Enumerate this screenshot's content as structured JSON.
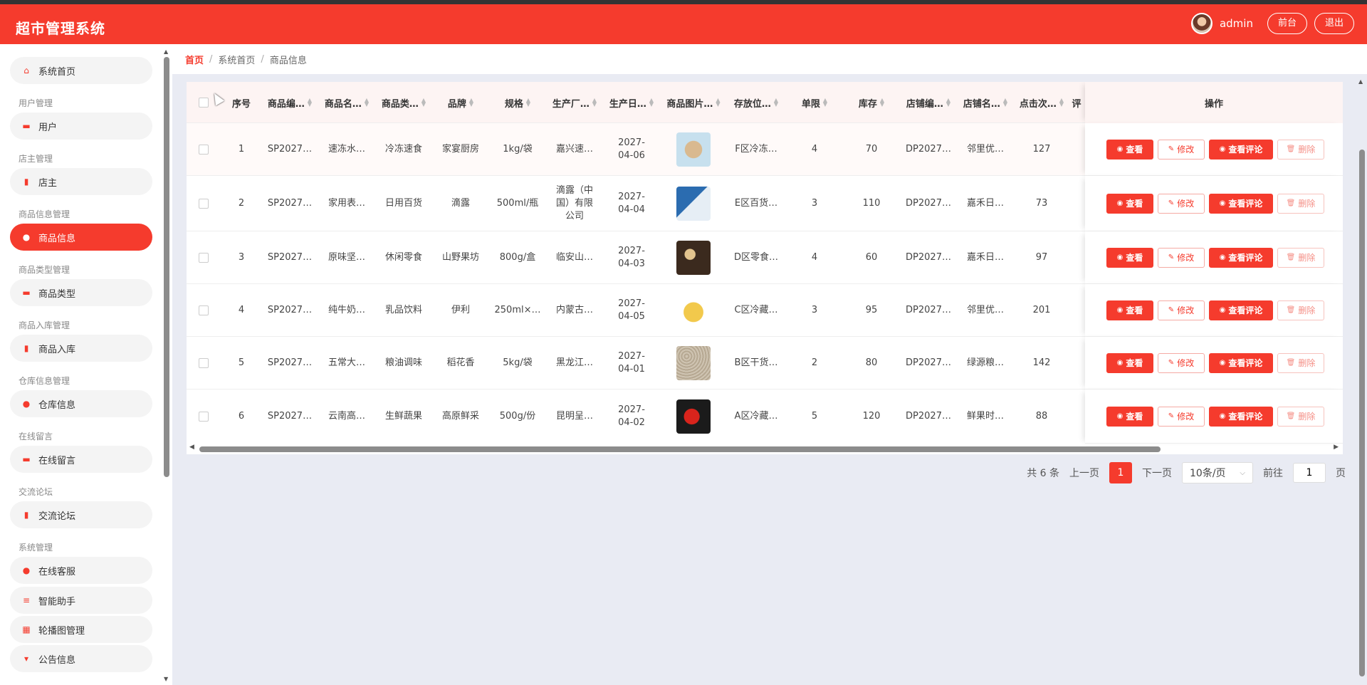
{
  "app": {
    "title": "超市管理系统"
  },
  "header": {
    "user": "admin",
    "front_btn": "前台",
    "logout_btn": "退出"
  },
  "sidebar": {
    "home": "系统首页",
    "groups": [
      {
        "title": "用户管理",
        "item": "用户",
        "icon": "briefcase-icon"
      },
      {
        "title": "店主管理",
        "item": "店主",
        "icon": "bar-chart-icon"
      },
      {
        "title": "商品信息管理",
        "item": "商品信息",
        "icon": "pin-icon"
      },
      {
        "title": "商品类型管理",
        "item": "商品类型",
        "icon": "briefcase-icon"
      },
      {
        "title": "商品入库管理",
        "item": "商品入库",
        "icon": "bar-chart-icon"
      },
      {
        "title": "仓库信息管理",
        "item": "仓库信息",
        "icon": "pin-icon"
      },
      {
        "title": "在线留言",
        "item": "在线留言",
        "icon": "briefcase-icon"
      },
      {
        "title": "交流论坛",
        "item": "交流论坛",
        "icon": "bar-chart-icon"
      }
    ],
    "system_group": "系统管理",
    "system_items": [
      "在线客服",
      "智能助手",
      "轮播图管理",
      "公告信息"
    ],
    "active": "商品信息"
  },
  "breadcrumb": [
    "首页",
    "系统首页",
    "商品信息"
  ],
  "table": {
    "columns": [
      "序号",
      "商品编…",
      "商品名…",
      "商品类…",
      "品牌",
      "规格",
      "生产厂…",
      "生产日…",
      "商品图片…",
      "存放位…",
      "单限",
      "库存",
      "店铺编…",
      "店铺名…",
      "点击次…",
      "评"
    ],
    "ops_header": "操作",
    "buttons": {
      "view": "查看",
      "edit": "修改",
      "comments": "查看评论",
      "delete": "删除"
    },
    "rows": [
      {
        "no": "1",
        "code": "SP2027…",
        "name": "速冻水…",
        "type": "冷冻速食",
        "brand": "家宴厨房",
        "spec": "1kg/袋",
        "maker": "嘉兴速…",
        "date": "2027-04-06",
        "loc": "F区冷冻…",
        "limit": "4",
        "stock": "70",
        "shop_code": "DP2027…",
        "shop": "邻里优…",
        "clicks": "127"
      },
      {
        "no": "2",
        "code": "SP2027…",
        "name": "家用表…",
        "type": "日用百货",
        "brand": "滴露",
        "spec": "500ml/瓶",
        "maker": "滴露（中国）有限公司",
        "date": "2027-04-04",
        "loc": "E区百货…",
        "limit": "3",
        "stock": "110",
        "shop_code": "DP2027…",
        "shop": "嘉禾日…",
        "clicks": "73"
      },
      {
        "no": "3",
        "code": "SP2027…",
        "name": "原味坚…",
        "type": "休闲零食",
        "brand": "山野果坊",
        "spec": "800g/盒",
        "maker": "临安山…",
        "date": "2027-04-03",
        "loc": "D区零食…",
        "limit": "4",
        "stock": "60",
        "shop_code": "DP2027…",
        "shop": "嘉禾日…",
        "clicks": "97"
      },
      {
        "no": "4",
        "code": "SP2027…",
        "name": "纯牛奶…",
        "type": "乳品饮料",
        "brand": "伊利",
        "spec": "250ml×…",
        "maker": "内蒙古…",
        "date": "2027-04-05",
        "loc": "C区冷藏…",
        "limit": "3",
        "stock": "95",
        "shop_code": "DP2027…",
        "shop": "邻里优…",
        "clicks": "201"
      },
      {
        "no": "5",
        "code": "SP2027…",
        "name": "五常大…",
        "type": "粮油调味",
        "brand": "稻花香",
        "spec": "5kg/袋",
        "maker": "黑龙江…",
        "date": "2027-04-01",
        "loc": "B区干货…",
        "limit": "2",
        "stock": "80",
        "shop_code": "DP2027…",
        "shop": "绿源粮…",
        "clicks": "142"
      },
      {
        "no": "6",
        "code": "SP2027…",
        "name": "云南高…",
        "type": "生鲜蔬果",
        "brand": "高原鲜采",
        "spec": "500g/份",
        "maker": "昆明呈…",
        "date": "2027-04-02",
        "loc": "A区冷藏…",
        "limit": "5",
        "stock": "120",
        "shop_code": "DP2027…",
        "shop": "鲜果时…",
        "clicks": "88"
      }
    ]
  },
  "pagination": {
    "total": "共 6 条",
    "prev": "上一页",
    "current": "1",
    "next": "下一页",
    "page_size": "10条/页",
    "goto": "前往",
    "goto_value": "1",
    "page_suffix": "页"
  }
}
